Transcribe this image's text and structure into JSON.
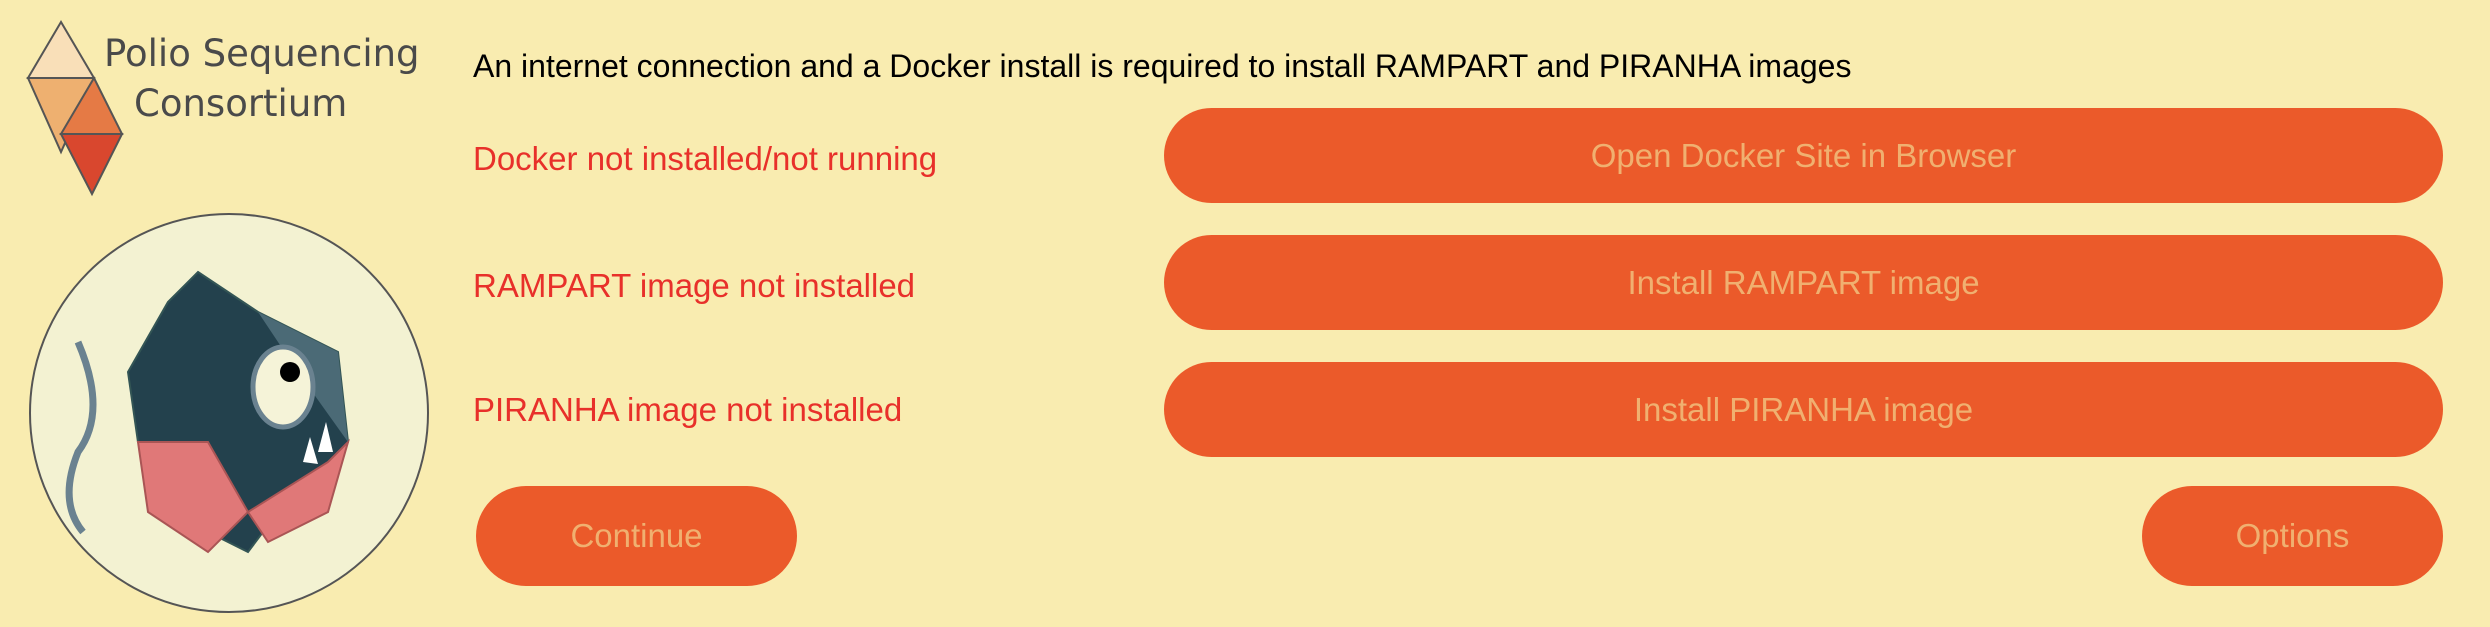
{
  "logo": {
    "line1": "Polio Sequencing",
    "line2": "Consortium"
  },
  "header": {
    "message": "An internet connection and a Docker install is required to install RAMPART and PIRANHA images"
  },
  "status": {
    "docker": "Docker not installed/not running",
    "rampart": "RAMPART image not installed",
    "piranha": "PIRANHA image not installed"
  },
  "buttons": {
    "open_docker": "Open Docker Site in Browser",
    "install_rampart": "Install RAMPART image",
    "install_piranha": "Install PIRANHA image",
    "continue": "Continue",
    "options": "Options"
  },
  "colors": {
    "background": "#f9ecb0",
    "button": "#eb5a2a",
    "button_text": "#f0b070",
    "error_text": "#e8302a"
  }
}
